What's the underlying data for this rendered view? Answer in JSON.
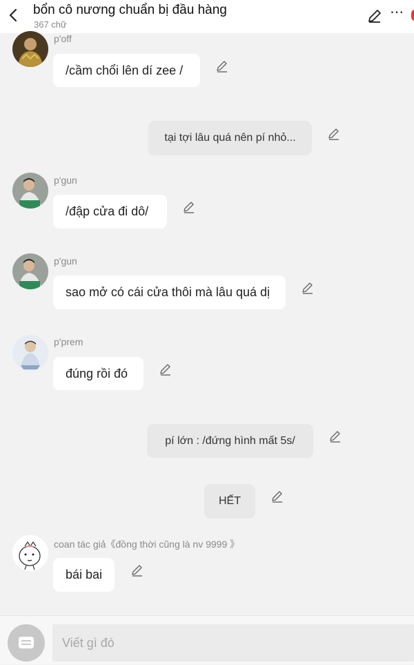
{
  "header": {
    "title": "bổn cô nương chuẩn bị đầu hàng",
    "subtitle": "367 chữ"
  },
  "messages": [
    {
      "name": "p'off",
      "text": "/cầm chổi lên dí zee /"
    },
    {
      "text": "tại tợi lâu quá nên pí nhỏ..."
    },
    {
      "name": "p'gun",
      "text": "/đập cửa đi dô/"
    },
    {
      "name": "p'gun",
      "text": "sao mở có cái cửa thôi mà lâu quá dị"
    },
    {
      "name": "p'prem",
      "text": "đúng rồi đó"
    },
    {
      "text": "pí lớn : /đứng hình mất 5s/"
    },
    {
      "text": "HẾT"
    },
    {
      "name": "coan tác giả《đồng thời cũng là nv 9999 》",
      "text": "bái bai"
    }
  ],
  "footer": {
    "input_placeholder": "Viết gì đó"
  },
  "colors": {
    "background": "#f2f2f2",
    "bubble": "#ffffff",
    "narration_bubble": "#e8e8e8",
    "accent_dot": "#e53935"
  }
}
